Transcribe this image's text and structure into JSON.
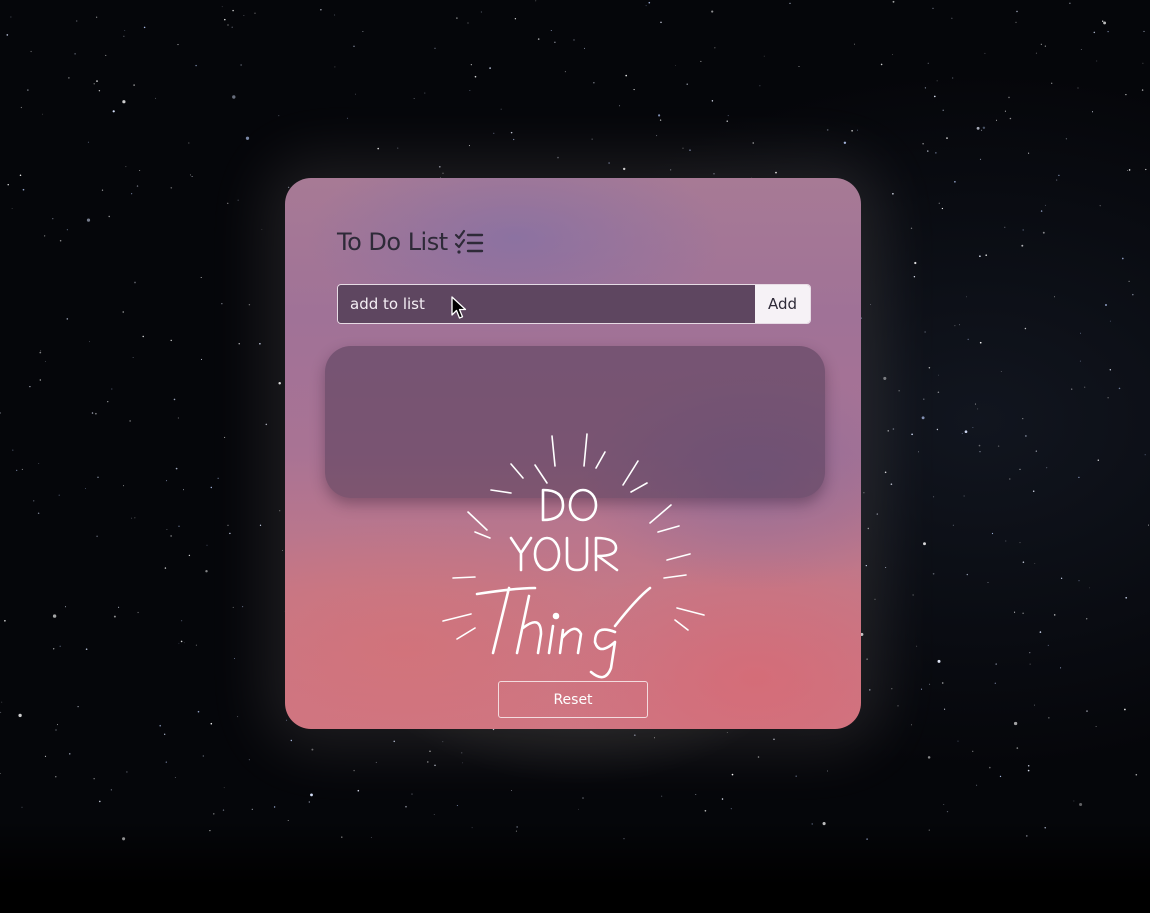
{
  "app": {
    "title": "To Do List",
    "title_icon": "checklist-icon"
  },
  "input": {
    "placeholder": "add to list",
    "value": ""
  },
  "buttons": {
    "add_label": "Add",
    "reset_label": "Reset"
  },
  "todo_items": [],
  "artwork": {
    "text_lines": [
      "DO",
      "YOUR",
      "Thing"
    ]
  },
  "colors": {
    "background": "#05060a",
    "card_top": "#a77a95",
    "card_bottom": "#cf7683",
    "input_bg": "#5e4660",
    "title_text": "#2e2a38"
  }
}
